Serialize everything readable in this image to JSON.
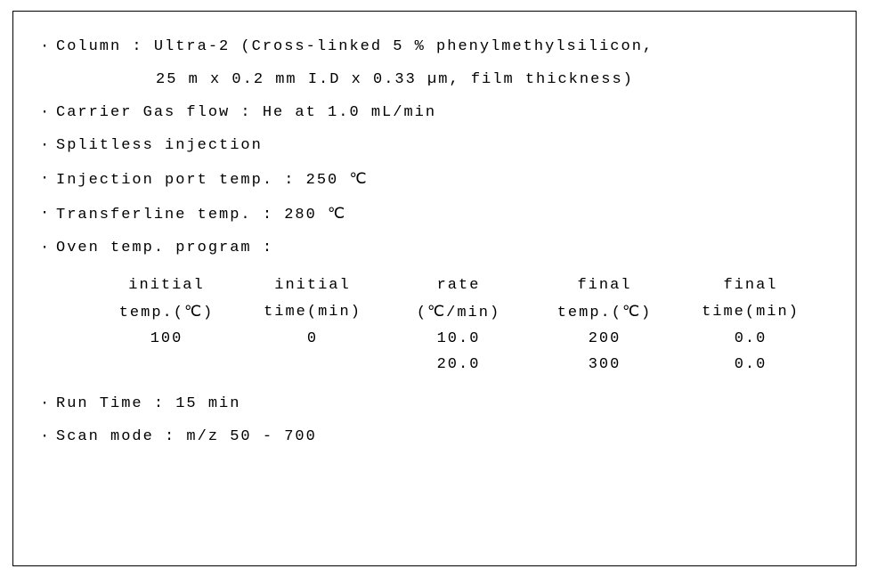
{
  "bullet": "·",
  "lines": {
    "column1": "Column : Ultra-2 (Cross-linked 5 % phenylmethylsilicon,",
    "column2": "25 m x 0.2 mm I.D x 0.33 µm, film thickness)",
    "carrier": "Carrier Gas flow : He at 1.0 mL/min",
    "splitless": "Splitless injection",
    "injport": "Injection port temp. : 250 ℃",
    "transfer": "Transferline temp. : 280 ℃",
    "ovenlabel": "Oven temp. program :",
    "runtime": "Run Time : 15 min",
    "scanmode": "Scan mode : m/z 50 - 700"
  },
  "oven": {
    "head1": [
      "initial",
      "initial",
      "rate",
      "final",
      "final"
    ],
    "head2": [
      "temp.(℃)",
      "time(min)",
      "(℃/min)",
      "temp.(℃)",
      "time(min)"
    ],
    "rows": [
      [
        "100",
        "0",
        "10.0",
        "200",
        "0.0"
      ],
      [
        "",
        "",
        "20.0",
        "300",
        "0.0"
      ]
    ]
  }
}
